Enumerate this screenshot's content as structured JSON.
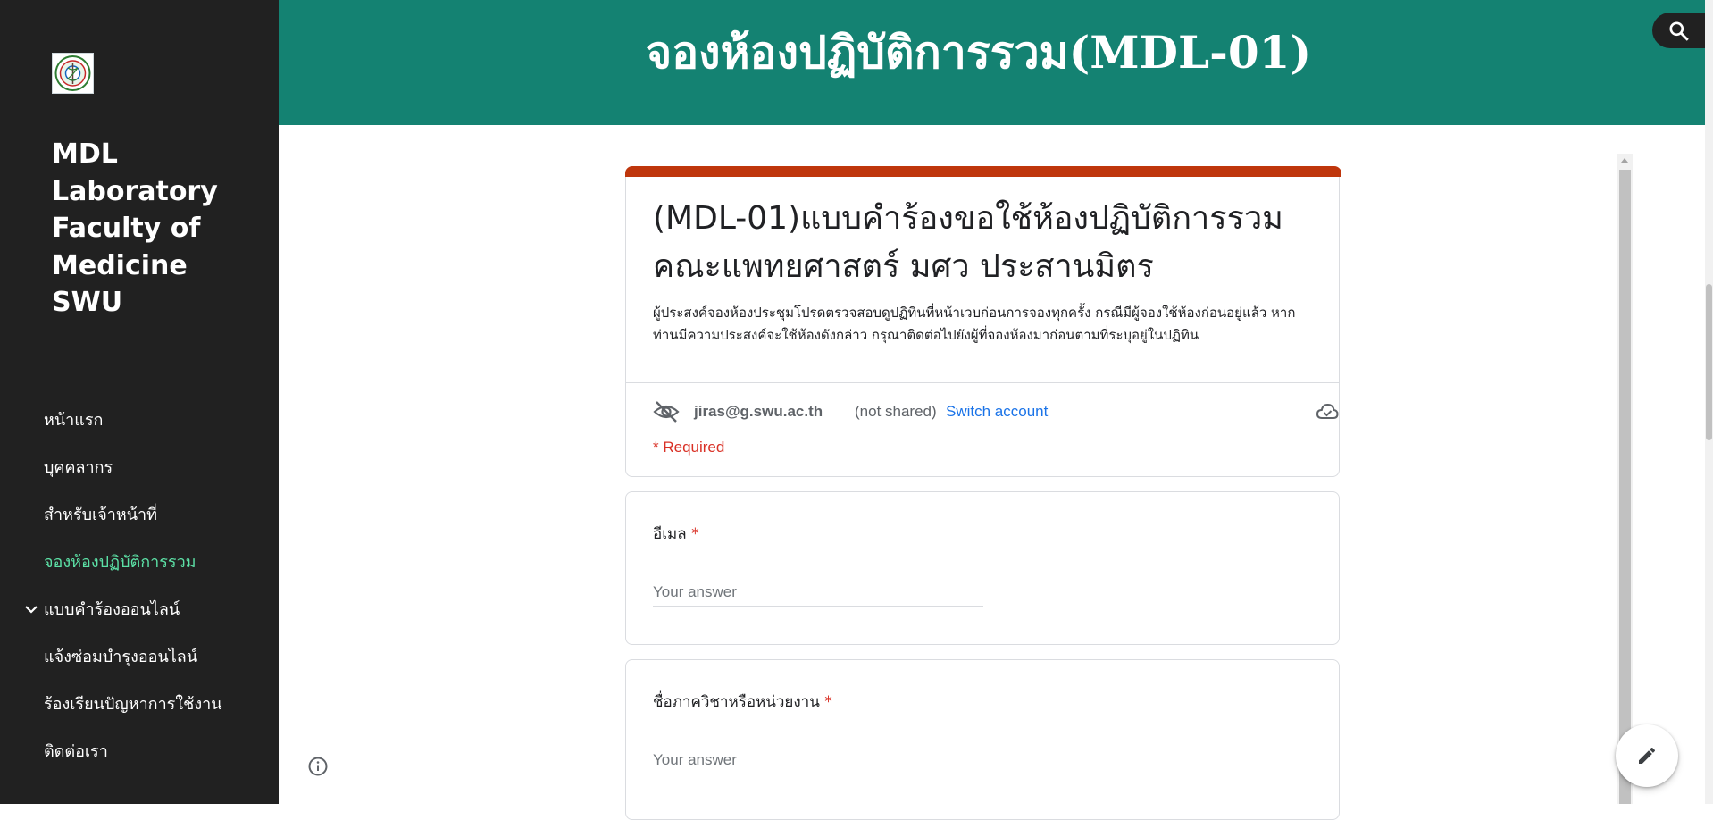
{
  "sidebar": {
    "logo_icon": "faculty-seal-logo",
    "site_title": "MDL Laboratory Faculty of Medicine SWU",
    "nav_items": [
      {
        "label": "หน้าแรก",
        "active": false,
        "expandable": false
      },
      {
        "label": "บุคคลากร",
        "active": false,
        "expandable": false
      },
      {
        "label": "สำหรับเจ้าหน้าที่",
        "active": false,
        "expandable": false
      },
      {
        "label": "จองห้องปฏิบัติการรวม",
        "active": true,
        "expandable": false
      },
      {
        "label": "แบบคำร้องออนไลน์",
        "active": false,
        "expandable": true
      },
      {
        "label": "แจ้งซ่อมบำรุงออนไลน์",
        "active": false,
        "expandable": false
      },
      {
        "label": "ร้องเรียนปัญหาการใช้งาน",
        "active": false,
        "expandable": false
      },
      {
        "label": "ติดต่อเรา",
        "active": false,
        "expandable": false
      }
    ],
    "info_icon": "info-icon"
  },
  "header": {
    "title": "จองห้องปฏิบัติการรวม(MDL-01)",
    "search_icon": "search-icon",
    "background_color": "#148272"
  },
  "form": {
    "accent_color": "#bf360c",
    "title": "(MDL-01)แบบคำร้องขอใช้ห้องปฏิบัติการรวม คณะแพทยศาสตร์ มศว ประสานมิตร",
    "description": "ผู้ประสงค์จองห้องประชุมโปรดตรวจสอบดูปฏิทินที่หน้าเวบก่อนการจองทุกครั้ง กรณีมีผู้จองใช้ห้องก่อนอยู่แล้ว หากท่านมีความประสงค์จะใช้ห้องดังกล่าว กรุณาติดต่อไปยังผู้ที่จองห้องมาก่อนตามที่ระบุอยู่ในปฏิทิน",
    "account": {
      "email": "jiras@g.swu.ac.th",
      "not_shared": "(not shared)",
      "switch_label": "Switch account"
    },
    "required_note": "* Required",
    "questions": [
      {
        "label": "อีเมล",
        "required_mark": "*",
        "placeholder": "Your answer"
      },
      {
        "label": "ชื่อภาควิชาหรือหน่วยงาน",
        "required_mark": "*",
        "placeholder": "Your answer"
      }
    ]
  },
  "fab": {
    "icon": "pencil-icon"
  }
}
